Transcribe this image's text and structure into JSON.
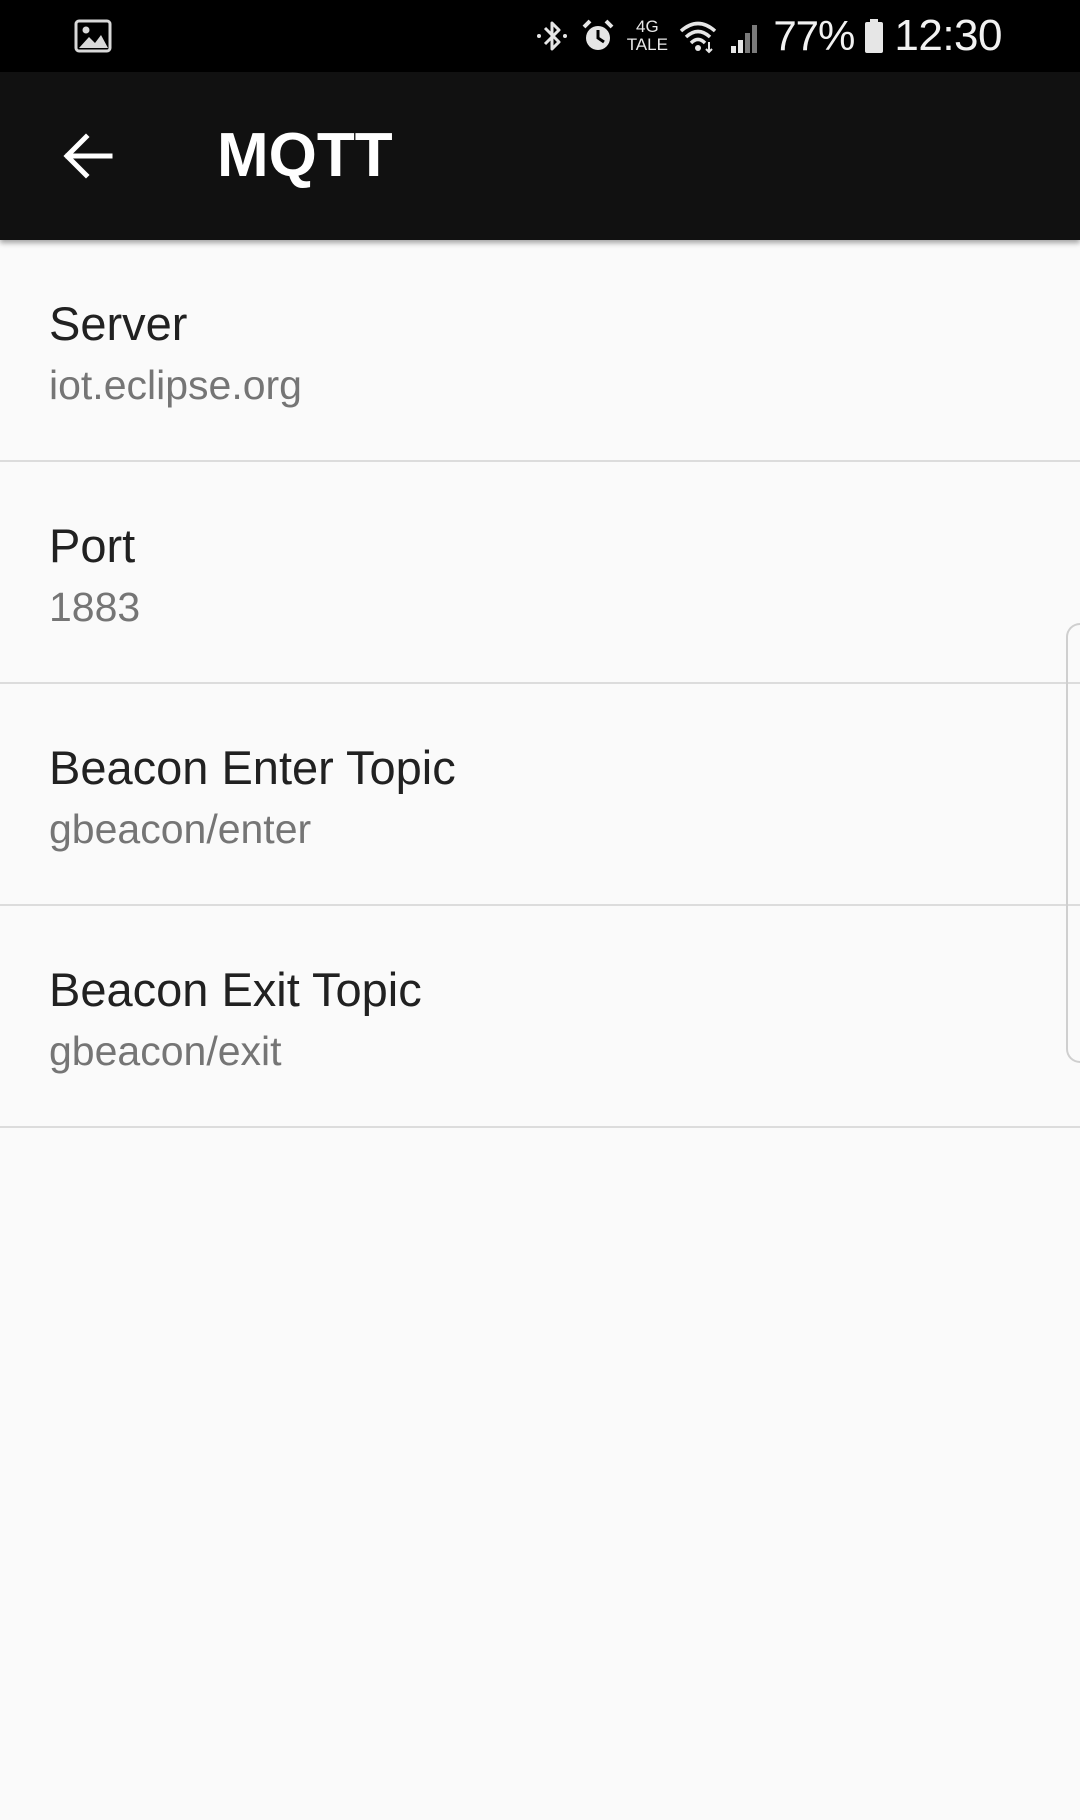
{
  "status_bar": {
    "left_icon": "gallery-notification-icon",
    "icons": [
      "bluetooth-icon",
      "alarm-icon",
      "wifi-icon",
      "signal-icon",
      "battery-icon"
    ],
    "network_top": "4G",
    "network_bottom": "TALE",
    "battery_percent": "77%",
    "time": "12:30"
  },
  "app_bar": {
    "back_icon": "arrow-back-icon",
    "title": "MQTT"
  },
  "preferences": [
    {
      "title": "Server",
      "summary": "iot.eclipse.org"
    },
    {
      "title": "Port",
      "summary": "1883"
    },
    {
      "title": "Beacon Enter Topic",
      "summary": "gbeacon/enter"
    },
    {
      "title": "Beacon Exit Topic",
      "summary": "gbeacon/exit"
    }
  ],
  "colors": {
    "status_bar_bg": "#000000",
    "app_bar_bg": "#111111",
    "page_bg": "#fafafa",
    "title_text": "#212121",
    "summary_text": "#757575",
    "divider": "#dcdcdc"
  }
}
